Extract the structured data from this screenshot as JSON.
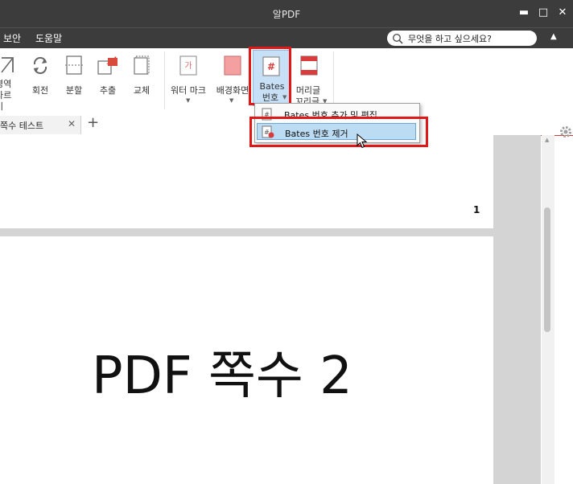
{
  "window": {
    "title": "알PDF",
    "minimize": "▬",
    "maximize": "□",
    "close": "✕"
  },
  "menubar": {
    "items": [
      "보안",
      "도움말"
    ],
    "search_placeholder": "무엇을 하고 싶으세요?",
    "collapse_icon": "▲"
  },
  "ribbon": {
    "items": [
      {
        "label1": "영역",
        "label2": "자르기"
      },
      {
        "label1": "회전"
      },
      {
        "label1": "분할"
      },
      {
        "label1": "추출"
      },
      {
        "label1": "교체"
      },
      {
        "label1": "워터 마크",
        "dropdown": true
      },
      {
        "label1": "배경화면",
        "dropdown": true
      },
      {
        "label1": "Bates",
        "label2": "번호",
        "dropdown": true,
        "active": true
      },
      {
        "label1": "머리글",
        "label2": "꼬리글",
        "dropdown": true
      }
    ]
  },
  "tabs": {
    "active_tab": "쪽수 테스트",
    "close_icon": "✕",
    "add_icon": "+"
  },
  "dropdown": {
    "items": [
      {
        "label": "Bates 번호 추가 및 편집"
      },
      {
        "label": "Bates 번호 제거",
        "highlighted": true
      }
    ]
  },
  "document": {
    "page1_number": "1",
    "page2_text": "PDF 쪽수 2"
  },
  "colors": {
    "titlebar": "#3c3c3c",
    "highlight_box": "#e01818",
    "hover": "#bcdcf4"
  }
}
